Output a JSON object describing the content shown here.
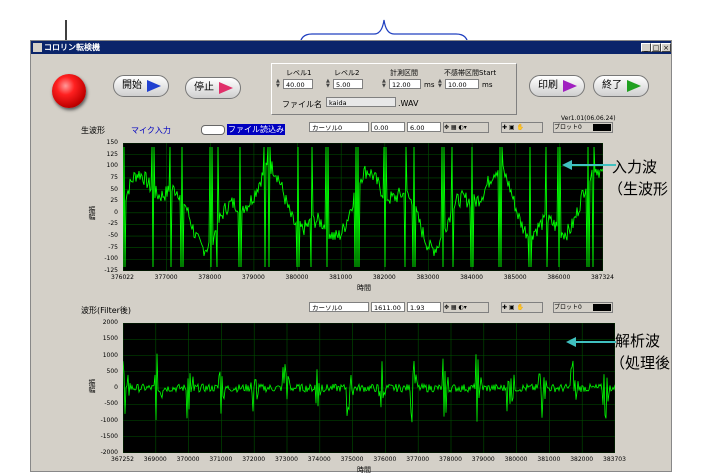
{
  "window": {
    "title": "コロリン転検機"
  },
  "controls": {
    "start_label": "開始",
    "stop_label": "停止",
    "print_label": "印刷",
    "exit_label": "終了",
    "level1_label": "レベル1",
    "level1_value": "40.00",
    "level2_label": "レベル2",
    "level2_value": "5.00",
    "measure_label": "計測区間",
    "measure_value": "12.00",
    "measure_unit": "ms",
    "dead_label": "不感帯区間Start",
    "dead_value": "10.00",
    "dead_unit": "ms",
    "filename_label": "ファイル名",
    "filename_value": "kaida",
    "filename_ext": ".WAV",
    "version": "Ver1.01(06.06.24)"
  },
  "graph1": {
    "title": "生波形",
    "mode_mic": "マイク入力",
    "mode_file": "ファイル読込み",
    "cursor_label": "カーソル0",
    "cursor_x": "0.00",
    "cursor_y": "6.00",
    "plot_label": "プロット0",
    "ylabel": "振幅",
    "xlabel": "時間",
    "yticks": [
      "150",
      "125",
      "100",
      "75",
      "50",
      "25",
      "0",
      "-25",
      "-50",
      "-75",
      "-100",
      "-125"
    ],
    "xticks": [
      "376022",
      "377000",
      "378000",
      "379000",
      "380000",
      "381000",
      "382000",
      "383000",
      "384000",
      "385000",
      "386000",
      "387324"
    ]
  },
  "graph2": {
    "title": "波形(Filter後)",
    "cursor_label": "カーソル0",
    "cursor_x": "1611.00",
    "cursor_y": "1.93",
    "plot_label": "プロット0",
    "ylabel": "振幅",
    "xlabel": "時間",
    "yticks": [
      "2000",
      "1500",
      "1000",
      "500",
      "0",
      "-500",
      "-1000",
      "-1500",
      "-2000"
    ],
    "xticks": [
      "367252",
      "369000",
      "370000",
      "371000",
      "372000",
      "373000",
      "374000",
      "375000",
      "376000",
      "377000",
      "378000",
      "379000",
      "380000",
      "381000",
      "382000",
      "383703"
    ]
  },
  "annotations": {
    "input_line1": "入力波",
    "input_line2": "（生波形",
    "analysis_line1": "解析波",
    "analysis_line2": "（処理後"
  },
  "colors": {
    "trace": "#00ff00",
    "grid": "#005000",
    "title_bar": "#0a246a",
    "annotation_arrow": "#40c0c0"
  }
}
